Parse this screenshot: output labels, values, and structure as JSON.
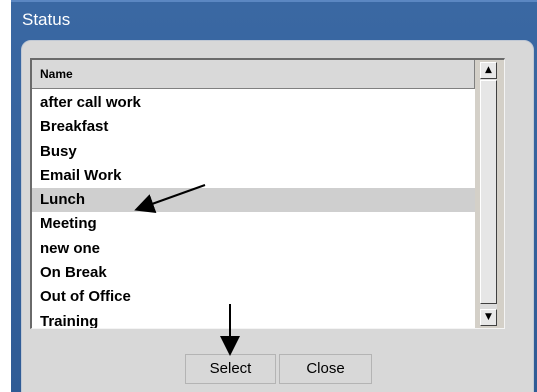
{
  "dialog": {
    "title": "Status"
  },
  "list": {
    "column_header": "Name",
    "items": [
      "after call work",
      "Breakfast",
      "Busy",
      "Email Work",
      "Lunch",
      "Meeting",
      "new one",
      "On Break",
      "Out of Office",
      "Training"
    ],
    "selected_item": "Lunch"
  },
  "scrollbar": {
    "up_icon": "scroll-up-arrow-icon",
    "down_icon": "scroll-down-arrow-icon"
  },
  "buttons": {
    "select_label": "Select",
    "close_label": "Close"
  },
  "colors": {
    "title_bar": "#3a68a3",
    "panel": "#d8d8d8",
    "selected_row": "#cfcfcf"
  }
}
